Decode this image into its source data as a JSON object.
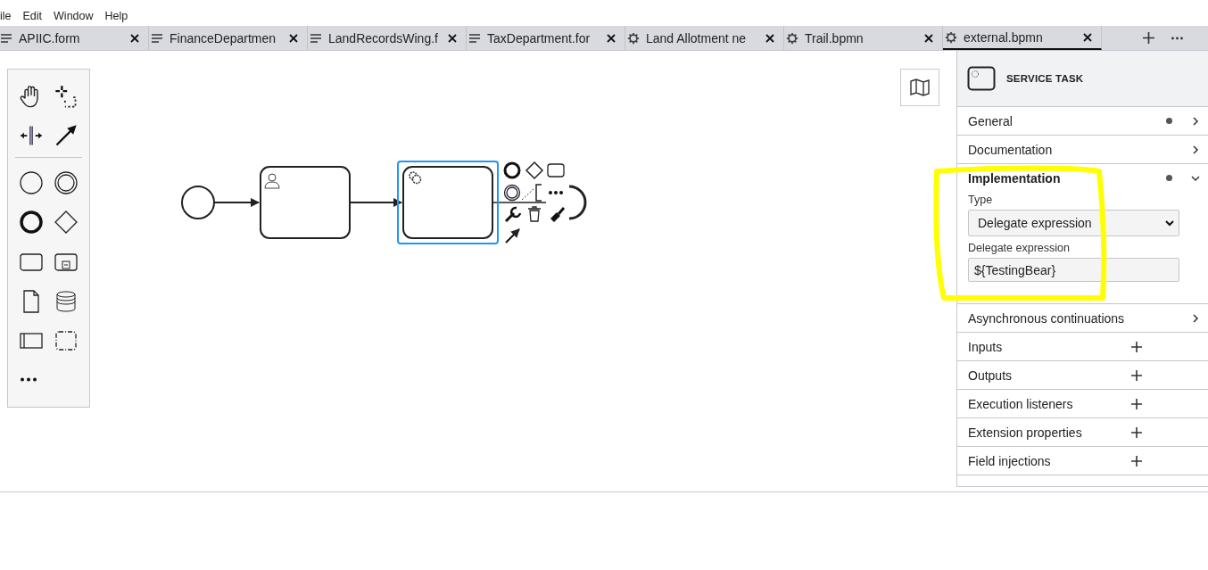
{
  "menu": [
    "ile",
    "Edit",
    "Window",
    "Help"
  ],
  "tabs": [
    {
      "kind": "form",
      "label": "APIIC.form",
      "selected": false
    },
    {
      "kind": "form",
      "label": "FinanceDepartmen",
      "selected": false
    },
    {
      "kind": "form",
      "label": "LandRecordsWing.f",
      "selected": false
    },
    {
      "kind": "form",
      "label": "TaxDepartment.for",
      "selected": false
    },
    {
      "kind": "bpmn",
      "label": "Land Allotment ne",
      "selected": false
    },
    {
      "kind": "bpmn",
      "label": "Trail.bpmn",
      "selected": false
    },
    {
      "kind": "bpmn",
      "label": "external.bpmn",
      "selected": true
    }
  ],
  "diagram": {
    "elements": [
      {
        "kind": "start_event",
        "selected": false
      },
      {
        "kind": "user_task",
        "selected": false
      },
      {
        "kind": "service_task",
        "selected": true
      }
    ]
  },
  "panel": {
    "title": "SERVICE TASK",
    "sections": [
      {
        "kind": "group",
        "label": "General",
        "has_data": true,
        "expanded": false
      },
      {
        "kind": "group",
        "label": "Documentation",
        "has_data": false,
        "expanded": false
      },
      {
        "kind": "group",
        "label": "Implementation",
        "has_data": true,
        "expanded": true,
        "fields": [
          {
            "kind": "select",
            "label": "Type",
            "value": "Delegate expression"
          },
          {
            "kind": "text",
            "label": "Delegate expression",
            "value": "${TestingBear}"
          }
        ]
      },
      {
        "kind": "group",
        "label": "Asynchronous continuations",
        "has_data": false,
        "expanded": false
      },
      {
        "kind": "list",
        "label": "Inputs"
      },
      {
        "kind": "list",
        "label": "Outputs"
      },
      {
        "kind": "list",
        "label": "Execution listeners"
      },
      {
        "kind": "list",
        "label": "Extension properties"
      },
      {
        "kind": "list",
        "label": "Field injections"
      }
    ]
  }
}
